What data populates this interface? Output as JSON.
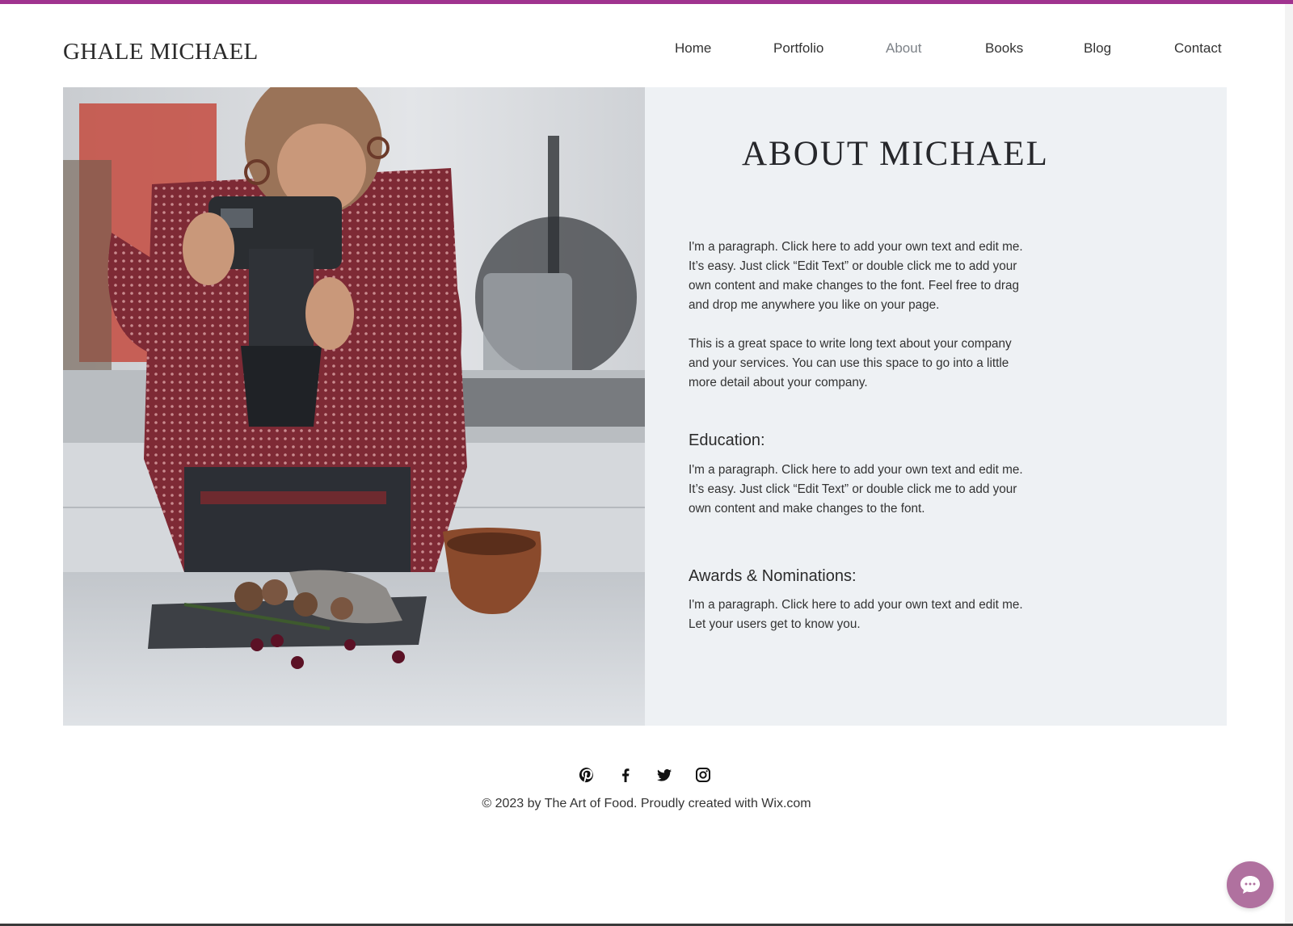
{
  "site": {
    "logo": "GHALE MICHAEL",
    "accent_color": "#a0338f"
  },
  "nav": {
    "items": [
      {
        "label": "Home",
        "active": false
      },
      {
        "label": "Portfolio",
        "active": false
      },
      {
        "label": "About",
        "active": true
      },
      {
        "label": "Books",
        "active": false
      },
      {
        "label": "Blog",
        "active": false
      },
      {
        "label": "Contact",
        "active": false
      }
    ]
  },
  "hero": {
    "image_icon": "photographer-photo",
    "title": "ABOUT MICHAEL",
    "intro_p1": "I'm a paragraph. Click here to add your own text and edit me. It’s easy. Just click “Edit Text” or double click me to add your own content and make changes to the font. Feel free to drag and drop me anywhere you like on your page.",
    "intro_p2": "This is a great space to write long text about your company and your services. You can use this space to go into a little more detail about your company.",
    "education_heading": "Education:",
    "education_text": "I'm a paragraph. Click here to add your own text and edit me. It’s easy. Just click “Edit Text” or double click me to add your own content and make changes to the font.",
    "awards_heading": "Awards & Nominations:",
    "awards_text": "I'm a paragraph. Click here to add your own text and edit me. Let your users get to know you."
  },
  "footer": {
    "social": [
      "pinterest-icon",
      "facebook-icon",
      "twitter-icon",
      "instagram-icon"
    ],
    "copyright": "© 2023 by The Art of Food. Proudly created with Wix.com"
  },
  "chat": {
    "icon": "chat-bubble-icon",
    "color": "#b0719f"
  }
}
